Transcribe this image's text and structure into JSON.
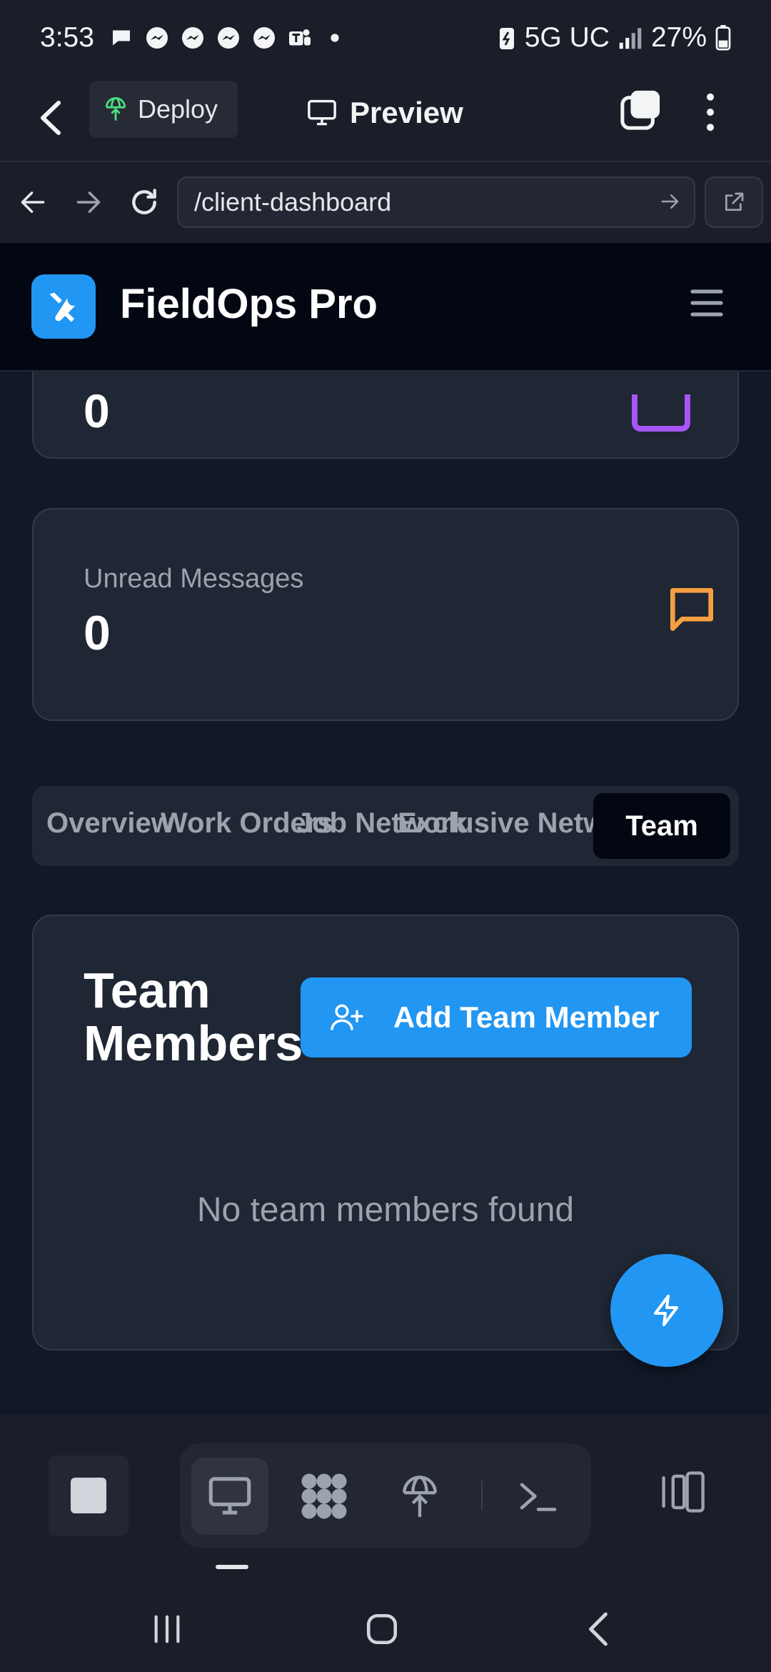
{
  "status_bar": {
    "time": "3:53",
    "network": "5G UC",
    "battery": "27%"
  },
  "app_bar": {
    "deploy_label": "Deploy",
    "preview_label": "Preview"
  },
  "browser": {
    "url": "/client-dashboard"
  },
  "site": {
    "brand": "FieldOps Pro"
  },
  "stats": [
    {
      "label": "",
      "value": "0",
      "icon": "calendar-icon",
      "color": "#a855f7"
    },
    {
      "label": "Unread Messages",
      "value": "0",
      "icon": "message-icon",
      "color": "#f59e42"
    }
  ],
  "tabs": [
    {
      "label": "Overview"
    },
    {
      "label": "Work Orders"
    },
    {
      "label": "Job Network"
    },
    {
      "label": "Exclusive Network"
    },
    {
      "label": "Team",
      "active": true
    }
  ],
  "team": {
    "title": "Team Members",
    "add_label": "Add Team Member",
    "empty_message": "No team members found"
  },
  "colors": {
    "accent": "#2196f3",
    "background": "#111827",
    "card": "#1f2634",
    "header": "#030712"
  }
}
